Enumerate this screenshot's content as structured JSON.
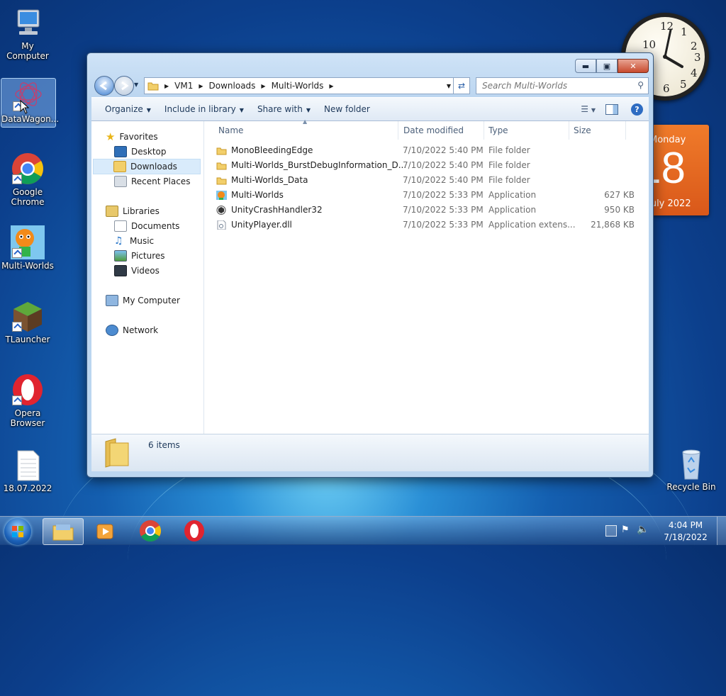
{
  "desktop": {
    "icons": [
      {
        "label": "My Computer",
        "icon": "computer-icon"
      },
      {
        "label": "DataWagon...",
        "icon": "datawagon-icon"
      },
      {
        "label": "Google Chrome",
        "icon": "chrome-icon"
      },
      {
        "label": "Multi-Worlds",
        "icon": "multi-worlds-icon"
      },
      {
        "label": "TLauncher",
        "icon": "tlauncher-icon"
      },
      {
        "label": "Opera Browser",
        "icon": "opera-icon"
      },
      {
        "label": "18.07.2022",
        "icon": "text-file-icon"
      },
      {
        "label": "Recycle Bin",
        "icon": "recycle-bin-icon"
      }
    ],
    "calendar": {
      "day_name": "Monday",
      "day_number": "18",
      "month_year": "July 2022"
    }
  },
  "window": {
    "address": {
      "crumbs": [
        "VM1",
        "Downloads",
        "Multi-Worlds"
      ]
    },
    "search_placeholder": "Search Multi-Worlds",
    "toolbar": {
      "organize": "Organize",
      "include": "Include in library",
      "share": "Share with",
      "new_folder": "New folder"
    },
    "nav": {
      "favorites": "Favorites",
      "desktop": "Desktop",
      "downloads": "Downloads",
      "recent": "Recent Places",
      "libraries": "Libraries",
      "documents": "Documents",
      "music": "Music",
      "pictures": "Pictures",
      "videos": "Videos",
      "my_computer": "My Computer",
      "network": "Network"
    },
    "columns": {
      "name": "Name",
      "date": "Date modified",
      "type": "Type",
      "size": "Size"
    },
    "files": [
      {
        "name": "MonoBleedingEdge",
        "date": "7/10/2022 5:40 PM",
        "type": "File folder",
        "size": "",
        "icon": "folder-icon"
      },
      {
        "name": "Multi-Worlds_BurstDebugInformation_D...",
        "date": "7/10/2022 5:40 PM",
        "type": "File folder",
        "size": "",
        "icon": "folder-icon"
      },
      {
        "name": "Multi-Worlds_Data",
        "date": "7/10/2022 5:40 PM",
        "type": "File folder",
        "size": "",
        "icon": "folder-icon"
      },
      {
        "name": "Multi-Worlds",
        "date": "7/10/2022 5:33 PM",
        "type": "Application",
        "size": "627 KB",
        "icon": "app-icon"
      },
      {
        "name": "UnityCrashHandler32",
        "date": "7/10/2022 5:33 PM",
        "type": "Application",
        "size": "950 KB",
        "icon": "unity-icon"
      },
      {
        "name": "UnityPlayer.dll",
        "date": "7/10/2022 5:33 PM",
        "type": "Application extens...",
        "size": "21,868 KB",
        "icon": "dll-icon"
      }
    ],
    "status": {
      "count": "6 items"
    }
  },
  "taskbar": {
    "time": "4:04 PM",
    "date": "7/18/2022"
  }
}
